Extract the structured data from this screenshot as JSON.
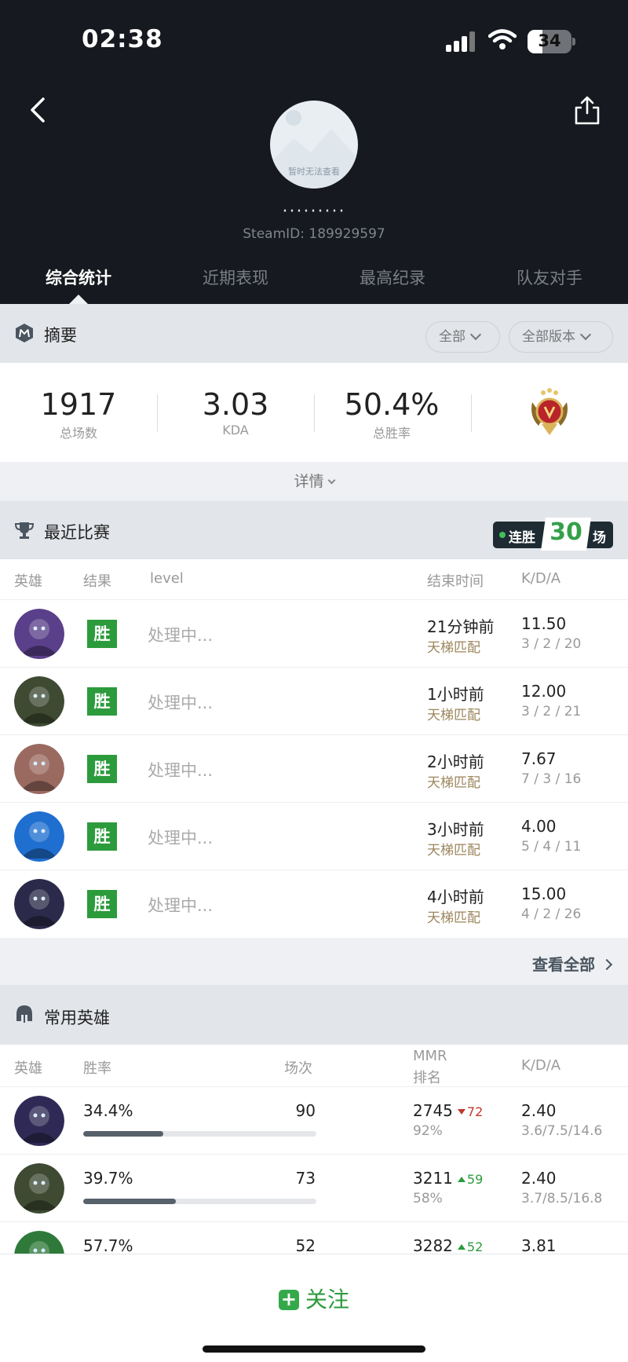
{
  "status_bar": {
    "time": "02:38",
    "battery": "34",
    "battery_level_percent": 34
  },
  "profile": {
    "avatar_text": "暂时无法查看",
    "nickname": "·········",
    "steam_id": "SteamID: 189929597"
  },
  "tabs": [
    "综合统计",
    "近期表现",
    "最高纪录",
    "队友对手"
  ],
  "summary": {
    "title": "摘要",
    "filter_all": "全部",
    "filter_version": "全部版本",
    "total_matches": "1917",
    "total_matches_label": "总场数",
    "kda": "3.03",
    "kda_label": "KDA",
    "win_rate": "50.4%",
    "win_rate_label": "总胜率",
    "details": "详情"
  },
  "recent": {
    "title": "最近比赛",
    "streak_label": "连胜",
    "streak_count": "30",
    "streak_unit": "场",
    "headers": {
      "hero": "英雄",
      "result": "结果",
      "level": "level",
      "end_time": "结束时间",
      "kda": "K/D/A"
    },
    "matches": [
      {
        "result": "胜",
        "level": "处理中...",
        "time": "21分钟前",
        "mode": "天梯匹配",
        "kda": "11.50",
        "kda_detail": "3 / 2 / 20",
        "hero_color": "#5a3f8a"
      },
      {
        "result": "胜",
        "level": "处理中...",
        "time": "1小时前",
        "mode": "天梯匹配",
        "kda": "12.00",
        "kda_detail": "3 / 2 / 21",
        "hero_color": "#3e4a32"
      },
      {
        "result": "胜",
        "level": "处理中...",
        "time": "2小时前",
        "mode": "天梯匹配",
        "kda": "7.67",
        "kda_detail": "7 / 3 / 16",
        "hero_color": "#9a6a60"
      },
      {
        "result": "胜",
        "level": "处理中...",
        "time": "3小时前",
        "mode": "天梯匹配",
        "kda": "4.00",
        "kda_detail": "5 / 4 / 11",
        "hero_color": "#1f6fd0"
      },
      {
        "result": "胜",
        "level": "处理中...",
        "time": "4小时前",
        "mode": "天梯匹配",
        "kda": "15.00",
        "kda_detail": "4 / 2 / 26",
        "hero_color": "#2b2a4a"
      }
    ],
    "view_all": "查看全部"
  },
  "heroes": {
    "title": "常用英雄",
    "headers": {
      "hero": "英雄",
      "win_rate": "胜率",
      "matches": "场次",
      "mmr": "MMR",
      "rank": "排名",
      "kda": "K/D/A"
    },
    "rows": [
      {
        "win_rate": "34.4%",
        "win_rate_value": 34.4,
        "matches": "90",
        "mmr": "2745",
        "delta": "72",
        "delta_dir": "down",
        "rank": "92%",
        "kda": "2.40",
        "kda_detail": "3.6/7.5/14.6",
        "hero_color": "#2f2a55"
      },
      {
        "win_rate": "39.7%",
        "win_rate_value": 39.7,
        "matches": "73",
        "mmr": "3211",
        "delta": "59",
        "delta_dir": "up",
        "rank": "58%",
        "kda": "2.40",
        "kda_detail": "3.7/8.5/16.8",
        "hero_color": "#3e4a32"
      },
      {
        "win_rate": "57.7%",
        "win_rate_value": 57.7,
        "matches": "52",
        "mmr": "3282",
        "delta": "52",
        "delta_dir": "up",
        "rank": "",
        "kda": "3.81",
        "kda_detail": "",
        "hero_color": "#2f7a3a"
      }
    ]
  },
  "footer": {
    "follow": "关注"
  }
}
